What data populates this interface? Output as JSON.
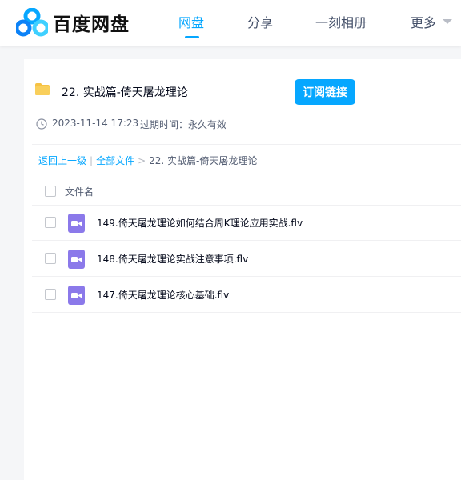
{
  "header": {
    "brand": "百度网盘",
    "nav": [
      "网盘",
      "分享",
      "一刻相册",
      "更多"
    ]
  },
  "share": {
    "title": "22. 实战篇-倚天屠龙理论",
    "subscribe_label": "订阅链接",
    "date": "2023-11-14 17:23",
    "expire": "过期时间：永久有效"
  },
  "breadcrumb": {
    "back": "返回上一级",
    "all_files": "全部文件",
    "separator": ">",
    "current": "22. 实战篇-倚天屠龙理论"
  },
  "file_list": {
    "column_header": "文件名",
    "files": [
      {
        "name": "149.倚天屠龙理论如何结合周K理论应用实战.flv"
      },
      {
        "name": "148.倚天屠龙理论实战注意事项.flv"
      },
      {
        "name": "147.倚天屠龙理论核心基础.flv"
      }
    ]
  },
  "colors": {
    "accent": "#06a7ff",
    "video_icon": "#8b79ea",
    "folder": "#f6c244"
  },
  "icons": [
    "baidu-netdisk-logo",
    "folder-icon",
    "clock-icon",
    "video-file-icon",
    "caret-down-icon"
  ]
}
